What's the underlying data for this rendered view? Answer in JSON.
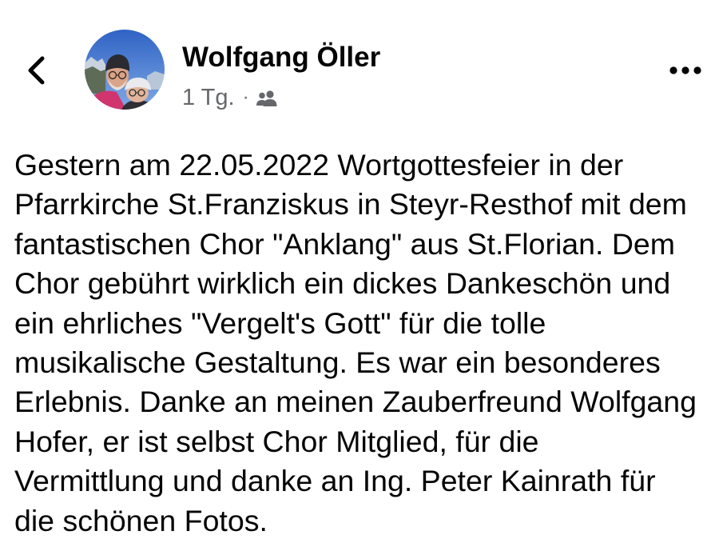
{
  "header": {
    "back_icon": "chevron-left-icon",
    "author_name": "Wolfgang Öller",
    "time": "1 Tg.",
    "separator": "·",
    "audience_icon": "friends-icon",
    "more_icon": "more-horizontal-icon"
  },
  "post": {
    "lines": [
      "Gestern am 22.05.2022 Wortgottesfeier in der",
      "Pfarrkirche St.Franziskus in Steyr-Resthof mit dem",
      "fantastischen Chor \"Anklang\" aus St.Florian. Dem",
      "Chor gebührt wirklich ein dickes Dankeschön und",
      "ein ehrliches \"Vergelt's Gott\" für die tolle",
      "musikalische Gestaltung. Es war ein besonderes",
      "Erlebnis. Danke an meinen Zauberfreund Wolfgang",
      "Hofer, er ist selbst Chor Mitglied, für die",
      "Vermittlung und danke an Ing. Peter Kainrath für",
      "die schönen Fotos."
    ]
  },
  "colors": {
    "text": "#050505",
    "secondary_text": "#65676b",
    "background": "#ffffff"
  }
}
